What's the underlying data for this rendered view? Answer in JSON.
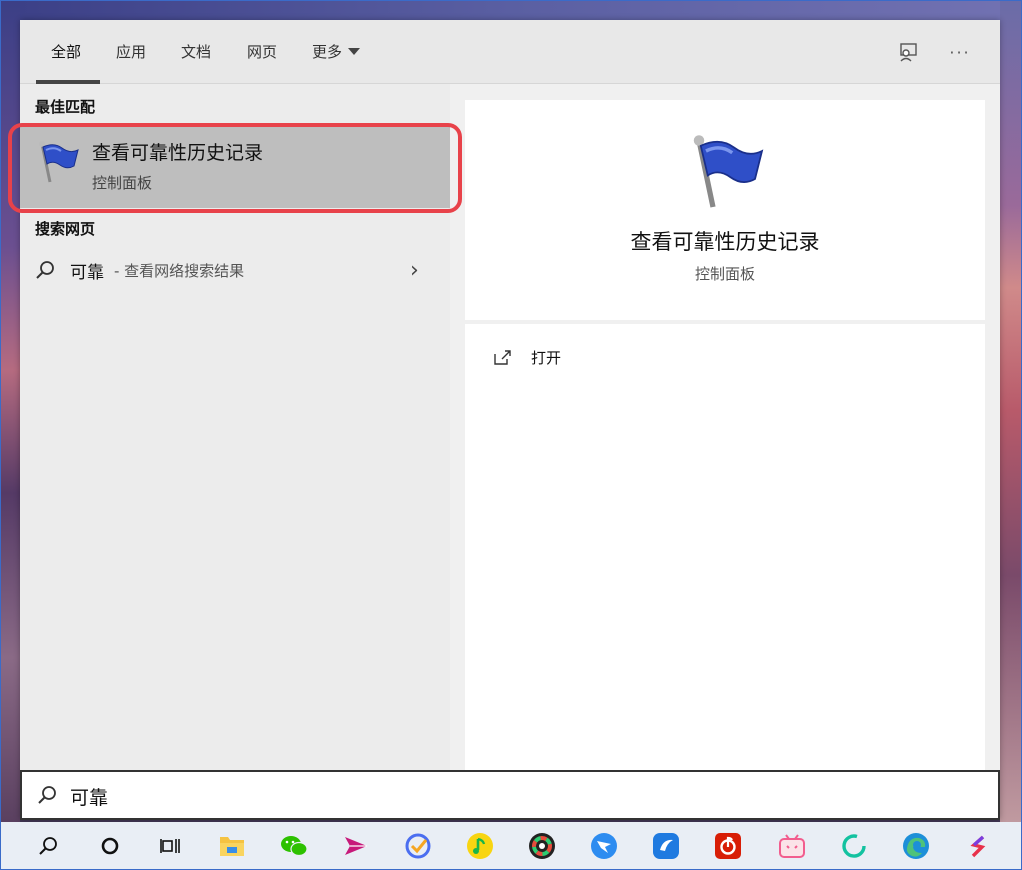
{
  "tabs": [
    {
      "label": "全部",
      "active": true
    },
    {
      "label": "应用"
    },
    {
      "label": "文档"
    },
    {
      "label": "网页"
    },
    {
      "label": "更多"
    }
  ],
  "top_icons": [
    "feedback-icon",
    "more-options-icon"
  ],
  "more_options_glyph": "···",
  "best_match": {
    "section_title": "最佳匹配",
    "title": "查看可靠性历史记录",
    "subtitle": "控制面板",
    "icon": "flag-icon"
  },
  "web": {
    "section_title": "搜索网页",
    "query": "可靠",
    "description": "- 查看网络搜索结果"
  },
  "detail": {
    "title": "查看可靠性历史记录",
    "subtitle": "控制面板",
    "actions": [
      {
        "label": "打开",
        "icon": "open-icon"
      }
    ]
  },
  "search": {
    "value": "可靠"
  },
  "taskbar": [
    "search-icon",
    "cortana-icon",
    "task-view-icon",
    "file-explorer-icon",
    "wechat-icon",
    "paper-plane-app-icon",
    "todo-check-icon",
    "qq-music-icon",
    "color-wheel-app-icon",
    "dingtalk-icon",
    "feishu-icon",
    "netease-music-icon",
    "bilibili-icon",
    "refresh-ring-app-icon",
    "edge-icon",
    "s-app-icon"
  ],
  "colors": {
    "highlight_ring": "#e8424a",
    "selected_item": "#bebebe",
    "accent_blue": "#2f5fd0"
  }
}
